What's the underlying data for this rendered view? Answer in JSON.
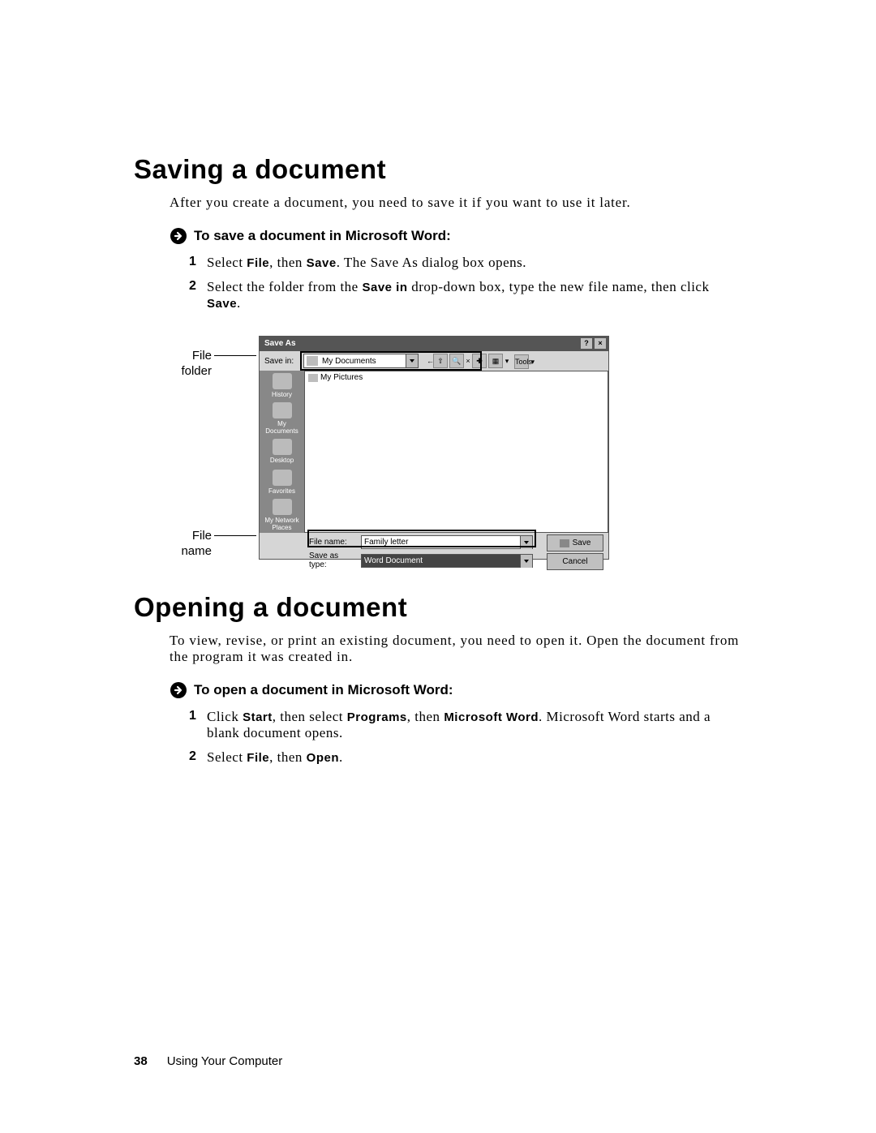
{
  "section1": {
    "heading": "Saving a document",
    "intro": "After you create a document, you need to save it if you want to use it later.",
    "subhead": "To save a document in Microsoft Word:",
    "steps": [
      {
        "pre": "Select ",
        "b1": "File",
        "mid": ", then ",
        "b2": "Save",
        "post": ". The Save As dialog box opens."
      },
      {
        "pre": "Select the folder from the ",
        "b1": "Save in",
        "mid": " drop-down box, type the new file name, then click ",
        "b2": "Save",
        "post": "."
      }
    ]
  },
  "callouts": {
    "filefolder": "File\nfolder",
    "filename": "File\nname"
  },
  "saveas": {
    "title": "Save As",
    "savein_label": "Save in:",
    "savein_value": "My Documents",
    "tools_label": "Tools",
    "places": [
      "History",
      "My Documents",
      "Desktop",
      "Favorites",
      "My Network Places"
    ],
    "filelist_item": "My Pictures",
    "filename_label": "File name:",
    "filename_value": "Family letter",
    "savetype_label": "Save as type:",
    "savetype_value": "Word Document",
    "save_btn": "Save",
    "cancel_btn": "Cancel"
  },
  "section2": {
    "heading": "Opening a document",
    "intro": "To view, revise, or print an existing document, you need to open it. Open the document from the program it was created in.",
    "subhead": "To open a document in Microsoft Word:",
    "steps": [
      {
        "pre": "Click ",
        "b1": "Start",
        "mid1": ", then select ",
        "b2": "Programs",
        "mid2": ", then ",
        "b3": "Microsoft Word",
        "post": ". Microsoft Word starts and a blank document opens."
      },
      {
        "pre": "Select ",
        "b1": "File",
        "mid": ", then ",
        "b2": "Open",
        "post": "."
      }
    ]
  },
  "footer": {
    "page": "38",
    "chapter": "Using Your Computer"
  }
}
